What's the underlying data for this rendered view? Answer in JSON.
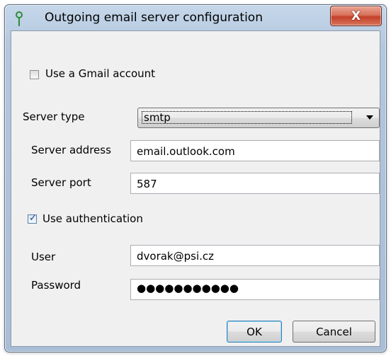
{
  "window": {
    "title": "Outgoing email server configuration",
    "close_label": "X",
    "icon": "pin-icon"
  },
  "gmail": {
    "label": "Use a Gmail account",
    "checked": false
  },
  "server_type": {
    "label": "Server type",
    "value": "smtp"
  },
  "server_address": {
    "label": "Server address",
    "value": "email.outlook.com"
  },
  "server_port": {
    "label": "Server port",
    "value": "587"
  },
  "authentication": {
    "label": "Use authentication",
    "checked": true
  },
  "user": {
    "label": "User",
    "value": "dvorak@psi.cz"
  },
  "password": {
    "label": "Password",
    "masked": "●●●●●●●●●●●"
  },
  "buttons": {
    "ok": "OK",
    "cancel": "Cancel"
  },
  "colors": {
    "accent": "#c4402a",
    "frame": "#b3c7de"
  }
}
